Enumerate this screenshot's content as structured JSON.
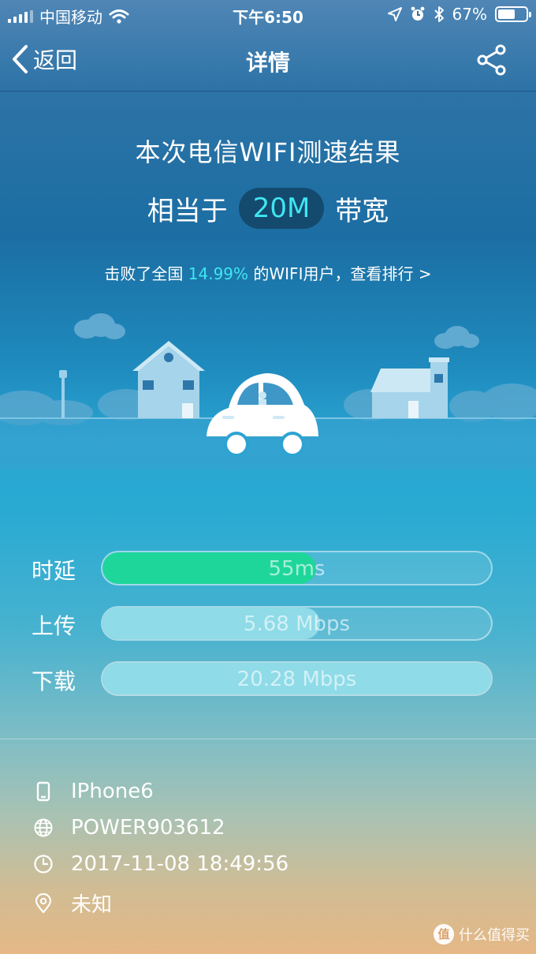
{
  "status_bar": {
    "carrier": "中国移动",
    "time": "下午6:50",
    "battery_percent": "67%",
    "battery_level": 0.67
  },
  "nav": {
    "back_label": "返回",
    "title": "详情"
  },
  "result": {
    "headline": "本次电信WIFI测速结果",
    "equiv_prefix": "相当于",
    "bandwidth": "20M",
    "equiv_suffix": "带宽",
    "rank_prefix": "击败了全国 ",
    "rank_percent": "14.99%",
    "rank_suffix": " 的WIFI用户，查看排行 >"
  },
  "metrics": [
    {
      "label": "时延",
      "value": "55ms",
      "fill_fraction": 0.55,
      "fill_color": "#1fd69a"
    },
    {
      "label": "上传",
      "value": "5.68 Mbps",
      "fill_fraction": 0.56,
      "fill_color": "#8fdbe8"
    },
    {
      "label": "下载",
      "value": "20.28 Mbps",
      "fill_fraction": 1.0,
      "fill_color": "#8fdbe8"
    }
  ],
  "info": {
    "device": "IPhone6",
    "network": "POWER903612",
    "datetime": "2017-11-08 18:49:56",
    "location": "未知"
  },
  "watermark": {
    "logo": "值",
    "text": "什么值得买"
  },
  "colors": {
    "accent": "#3fe6f1",
    "pill_bg": "#144a6e",
    "latency_fill": "#1fd69a"
  }
}
